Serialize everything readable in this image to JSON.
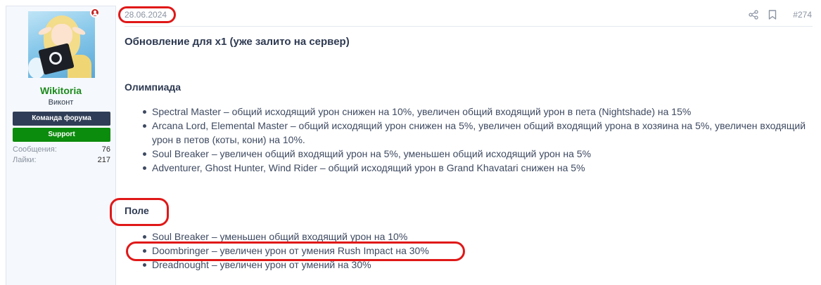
{
  "user": {
    "name": "Wikitoria",
    "title": "Виконт",
    "banner_team": "Команда форума",
    "banner_support": "Support",
    "stats": {
      "messages_label": "Сообщения:",
      "messages_value": "76",
      "likes_label": "Лайки:",
      "likes_value": "217"
    },
    "status_icon": "user-online-icon"
  },
  "post": {
    "date": "28.06.2024",
    "number": "#274",
    "title": "Обновление для x1 (уже залито на сервер)",
    "icons": [
      "share-icon",
      "bookmark-icon"
    ],
    "sections": [
      {
        "title": "Олимпиада",
        "items": [
          "Spectral Master – общий исходящий урон снижен на 10%, увеличен общий входящий урон в пета (Nightshade) на 15%",
          "Arcana Lord, Elemental Master – общий исходящий урон снижен на 5%, увеличен общий входящий урона в хозяина на 5%, увеличен входящий урон в петов (коты, кони) на 10%.",
          "Soul Breaker – увеличен общий входящий урон на 5%, уменьшен общий исходящий урон на 5%",
          "Adventurer, Ghost Hunter, Wind Rider – общий исходящий урон в Grand Khavatari снижен на 5%"
        ]
      },
      {
        "title": "Поле",
        "items": [
          "Soul Breaker – уменьшен общий входящий урон на 10%",
          "Doombringer – увеличен урон от умения Rush Impact на 30%",
          "Dreadnought – увеличен урон от умений на 30%"
        ]
      }
    ]
  },
  "colors": {
    "highlight": "#e01818",
    "username": "#1c8b1c",
    "team_banner": "#2f3e56",
    "support_banner": "#0c8c0c"
  }
}
